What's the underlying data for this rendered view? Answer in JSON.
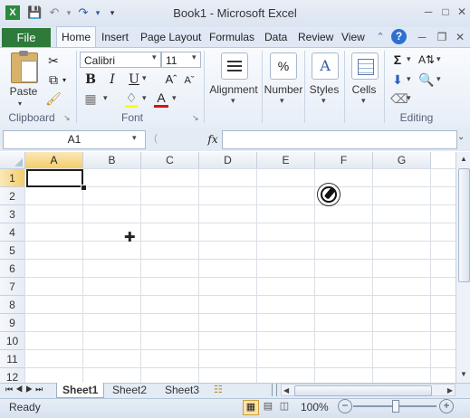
{
  "window": {
    "title": "Book1 - Microsoft Excel"
  },
  "qat": {
    "save_icon": "save-icon",
    "undo_icon": "undo-icon",
    "redo_icon": "redo-icon"
  },
  "ribbon_tabs": [
    {
      "label": "File"
    },
    {
      "label": "Home"
    },
    {
      "label": "Insert"
    },
    {
      "label": "Page Layout"
    },
    {
      "label": "Formulas"
    },
    {
      "label": "Data"
    },
    {
      "label": "Review"
    },
    {
      "label": "View"
    }
  ],
  "clipboard": {
    "paste_label": "Paste",
    "group_label": "Clipboard"
  },
  "font": {
    "name": "Calibri",
    "size": "11",
    "group_label": "Font",
    "bold": "B",
    "italic": "I",
    "underline": "U"
  },
  "alignment": {
    "label": "Alignment"
  },
  "number": {
    "label": "Number",
    "glyph": "%"
  },
  "styles": {
    "label": "Styles"
  },
  "cells": {
    "label": "Cells"
  },
  "editing": {
    "group_label": "Editing",
    "sum_glyph": "Σ"
  },
  "formula_bar": {
    "name_box": "A1",
    "fx": "fx",
    "formula": ""
  },
  "grid": {
    "columns": [
      "A",
      "B",
      "C",
      "D",
      "E",
      "F",
      "G"
    ],
    "rows": [
      "1",
      "2",
      "3",
      "4",
      "5",
      "6",
      "7",
      "8",
      "9",
      "10",
      "11",
      "12"
    ],
    "selected_cell": "A1"
  },
  "sheets": [
    {
      "label": "Sheet1"
    },
    {
      "label": "Sheet2"
    },
    {
      "label": "Sheet3"
    }
  ],
  "status": {
    "ready": "Ready",
    "zoom": "100%",
    "zoom_level": 1.0
  },
  "colors": {
    "file_tab": "#2d7a3a",
    "selection_header": "#f4cd6a"
  }
}
